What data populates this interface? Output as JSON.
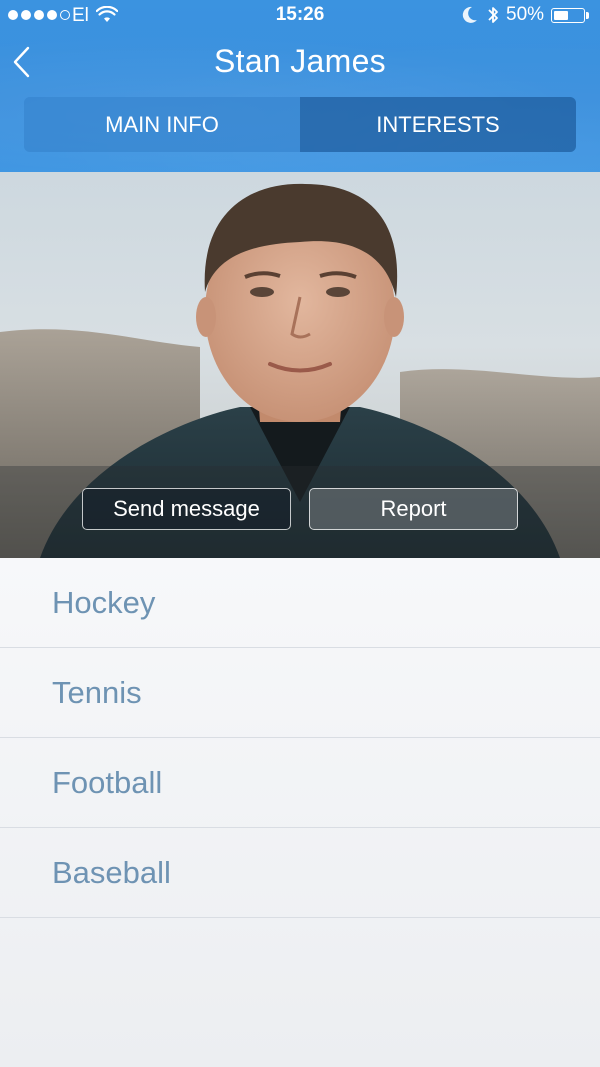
{
  "status_bar": {
    "carrier": "El",
    "time": "15:26",
    "battery_percent": "50%",
    "battery_level": 0.5,
    "signal_bars": 4,
    "signal_total": 5
  },
  "header": {
    "title": "Stan James",
    "back_icon": "chevron-left-icon"
  },
  "tabs": [
    {
      "label": "MAIN INFO",
      "selected": false
    },
    {
      "label": "INTERESTS",
      "selected": true
    }
  ],
  "profile": {
    "send_message_label": "Send message",
    "report_label": "Report"
  },
  "interests": [
    {
      "label": "Hockey"
    },
    {
      "label": "Tennis"
    },
    {
      "label": "Football"
    },
    {
      "label": "Baseball"
    }
  ],
  "colors": {
    "header_blue": "#3a8fdd",
    "list_text": "#6e93b3"
  }
}
